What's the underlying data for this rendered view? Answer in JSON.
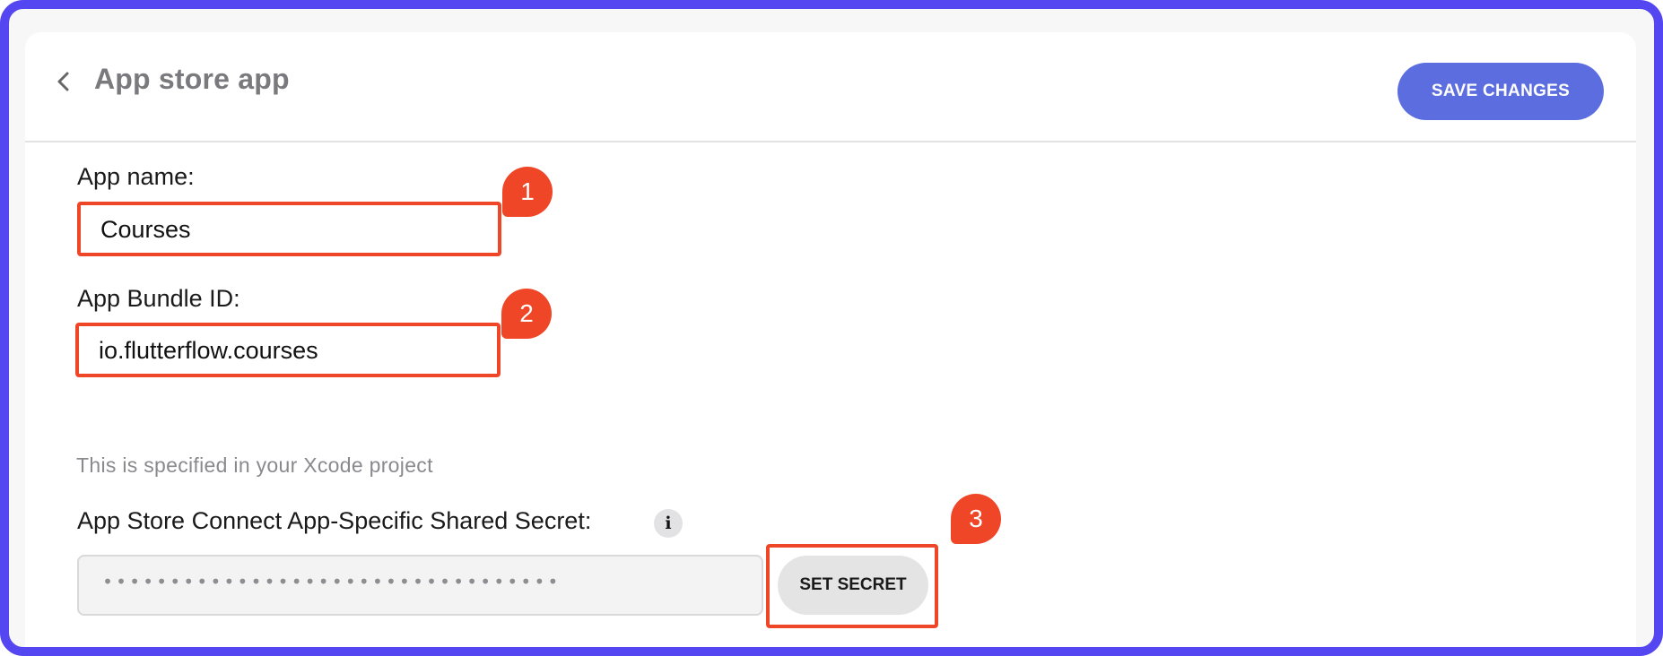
{
  "header": {
    "title": "App store app",
    "back_icon": "chevron-left-icon",
    "save_label": "SAVE CHANGES"
  },
  "form": {
    "app_name": {
      "label": "App name:",
      "value": "Courses"
    },
    "bundle_id": {
      "label": "App Bundle ID:",
      "value": "io.flutterflow.courses",
      "helper": "This is specified in your Xcode project"
    },
    "shared_secret": {
      "label": "App Store Connect App-Specific Shared Secret:",
      "info_icon": "info-icon",
      "info_glyph": "i",
      "masked_value": "••••••••••••••••••••••••••••••••••",
      "button_label": "SET SECRET"
    }
  },
  "annotations": {
    "badge_1": "1",
    "badge_2": "2",
    "badge_3": "3"
  },
  "colors": {
    "frame": "#5446F0",
    "primary_button": "#5c6ddf",
    "annotation": "#ef4627"
  }
}
